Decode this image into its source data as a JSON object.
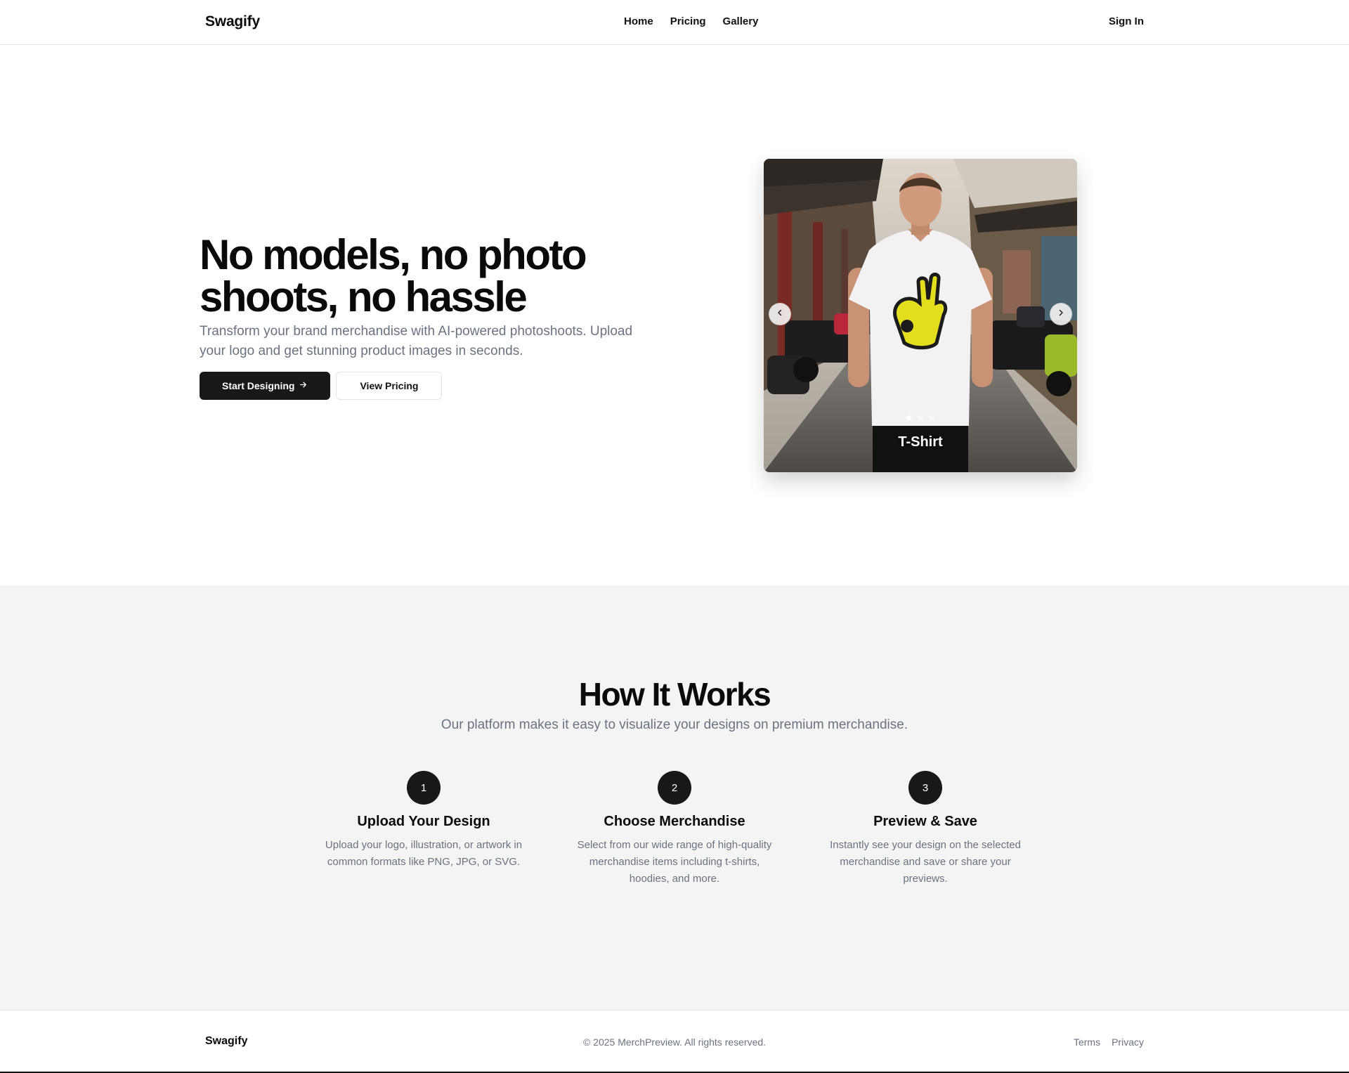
{
  "header": {
    "brand": "Swagify",
    "nav": [
      "Home",
      "Pricing",
      "Gallery"
    ],
    "sign_in": "Sign In"
  },
  "hero": {
    "title": "No models, no photo shoots, no hassle",
    "subtitle": "Transform your brand merchandise with AI-powered photoshoots. Upload your logo and get stunning product images in seconds.",
    "primary_button": "Start Designing",
    "secondary_button": "View Pricing",
    "carousel": {
      "slide_label": "T-Shirt",
      "slide_count": 3,
      "active_slide": 1,
      "prev_icon": "chevron-left-icon",
      "next_icon": "chevron-right-icon"
    }
  },
  "how": {
    "title": "How It Works",
    "subtitle": "Our platform makes it easy to visualize your designs on premium merchandise.",
    "steps": [
      {
        "num": "1",
        "title": "Upload Your Design",
        "desc": "Upload your logo, illustration, or artwork in common formats like PNG, JPG, or SVG."
      },
      {
        "num": "2",
        "title": "Choose Merchandise",
        "desc": "Select from our wide range of high-quality merchandise items including t-shirts, hoodies, and more."
      },
      {
        "num": "3",
        "title": "Preview & Save",
        "desc": "Instantly see your design on the selected merchandise and save or share your previews."
      }
    ]
  },
  "footer": {
    "brand": "Swagify",
    "copyright": "© 2025 MerchPreview. All rights reserved.",
    "links": [
      "Terms",
      "Privacy"
    ]
  },
  "colors": {
    "primary": "#18181b",
    "muted_text": "#6b7280",
    "section_bg": "#f4f4f5",
    "logo_yellow": "#e3df1f"
  }
}
